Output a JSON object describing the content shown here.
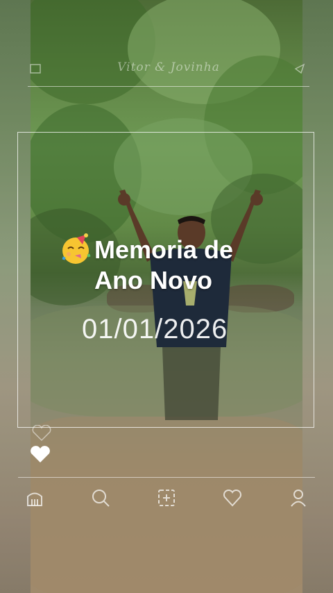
{
  "app": {
    "header_script": "Vitor & Jovinha"
  },
  "card": {
    "emoji": "partying-face-emoji",
    "title_line1": "Memoria de",
    "title_line2": "Ano Novo",
    "date": "01/01/2026"
  },
  "bottom_nav": {
    "items": [
      {
        "name": "nav-home",
        "icon": "home-icon"
      },
      {
        "name": "nav-search",
        "icon": "search-icon"
      },
      {
        "name": "nav-add",
        "icon": "add-icon"
      },
      {
        "name": "nav-likes",
        "icon": "heart-icon"
      },
      {
        "name": "nav-profile",
        "icon": "profile-icon"
      }
    ]
  },
  "colors": {
    "text": "#ffffff",
    "line": "rgba(255,255,255,0.55)"
  }
}
